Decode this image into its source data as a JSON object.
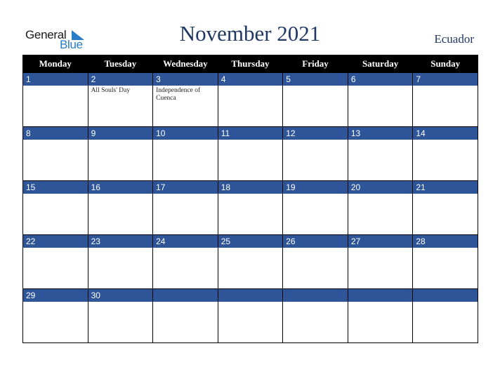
{
  "logo": {
    "line1": "General",
    "line2": "Blue"
  },
  "header": {
    "title": "November 2021",
    "country": "Ecuador"
  },
  "colors": {
    "accent": "#2e5597",
    "title": "#1f3864",
    "header_bg": "#000000",
    "logo_blue": "#2a7cc7"
  },
  "weekdays": [
    "Monday",
    "Tuesday",
    "Wednesday",
    "Thursday",
    "Friday",
    "Saturday",
    "Sunday"
  ],
  "weeks": [
    [
      {
        "day": "1",
        "holiday": ""
      },
      {
        "day": "2",
        "holiday": "All Souls' Day"
      },
      {
        "day": "3",
        "holiday": "Independence of Cuenca"
      },
      {
        "day": "4",
        "holiday": ""
      },
      {
        "day": "5",
        "holiday": ""
      },
      {
        "day": "6",
        "holiday": ""
      },
      {
        "day": "7",
        "holiday": ""
      }
    ],
    [
      {
        "day": "8",
        "holiday": ""
      },
      {
        "day": "9",
        "holiday": ""
      },
      {
        "day": "10",
        "holiday": ""
      },
      {
        "day": "11",
        "holiday": ""
      },
      {
        "day": "12",
        "holiday": ""
      },
      {
        "day": "13",
        "holiday": ""
      },
      {
        "day": "14",
        "holiday": ""
      }
    ],
    [
      {
        "day": "15",
        "holiday": ""
      },
      {
        "day": "16",
        "holiday": ""
      },
      {
        "day": "17",
        "holiday": ""
      },
      {
        "day": "18",
        "holiday": ""
      },
      {
        "day": "19",
        "holiday": ""
      },
      {
        "day": "20",
        "holiday": ""
      },
      {
        "day": "21",
        "holiday": ""
      }
    ],
    [
      {
        "day": "22",
        "holiday": ""
      },
      {
        "day": "23",
        "holiday": ""
      },
      {
        "day": "24",
        "holiday": ""
      },
      {
        "day": "25",
        "holiday": ""
      },
      {
        "day": "26",
        "holiday": ""
      },
      {
        "day": "27",
        "holiday": ""
      },
      {
        "day": "28",
        "holiday": ""
      }
    ],
    [
      {
        "day": "29",
        "holiday": ""
      },
      {
        "day": "30",
        "holiday": ""
      },
      {
        "day": "",
        "holiday": ""
      },
      {
        "day": "",
        "holiday": ""
      },
      {
        "day": "",
        "holiday": ""
      },
      {
        "day": "",
        "holiday": ""
      },
      {
        "day": "",
        "holiday": ""
      }
    ]
  ]
}
